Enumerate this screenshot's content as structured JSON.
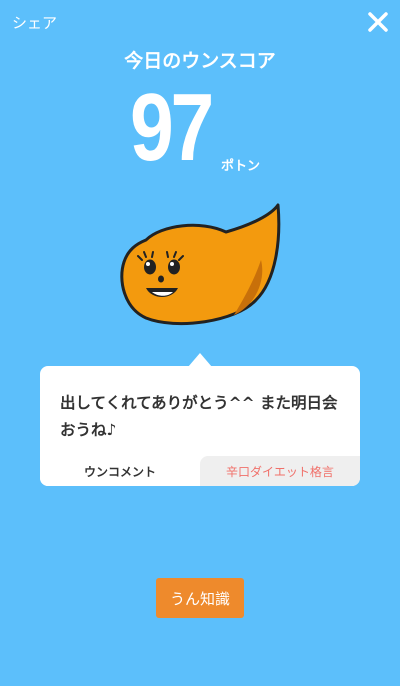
{
  "header": {
    "share_label": "シェア",
    "close_icon": "close-icon"
  },
  "title": "今日のウンスコア",
  "score": {
    "value": "97",
    "unit": "ポトン"
  },
  "mascot": {
    "icon": "poop-mascot-icon",
    "color": "#F39A0E"
  },
  "comment": {
    "text": "出してくれてありがとう^^ また明日会おうね♪",
    "tabs": [
      {
        "label": "ウンコメント",
        "active": true
      },
      {
        "label": "辛口ダイエット格言",
        "active": false
      }
    ]
  },
  "knowledge_button": {
    "label": "うん知識"
  },
  "colors": {
    "background": "#5CBFFB",
    "accent": "#EE8A2C",
    "tab_inactive_text": "#F0706A"
  }
}
